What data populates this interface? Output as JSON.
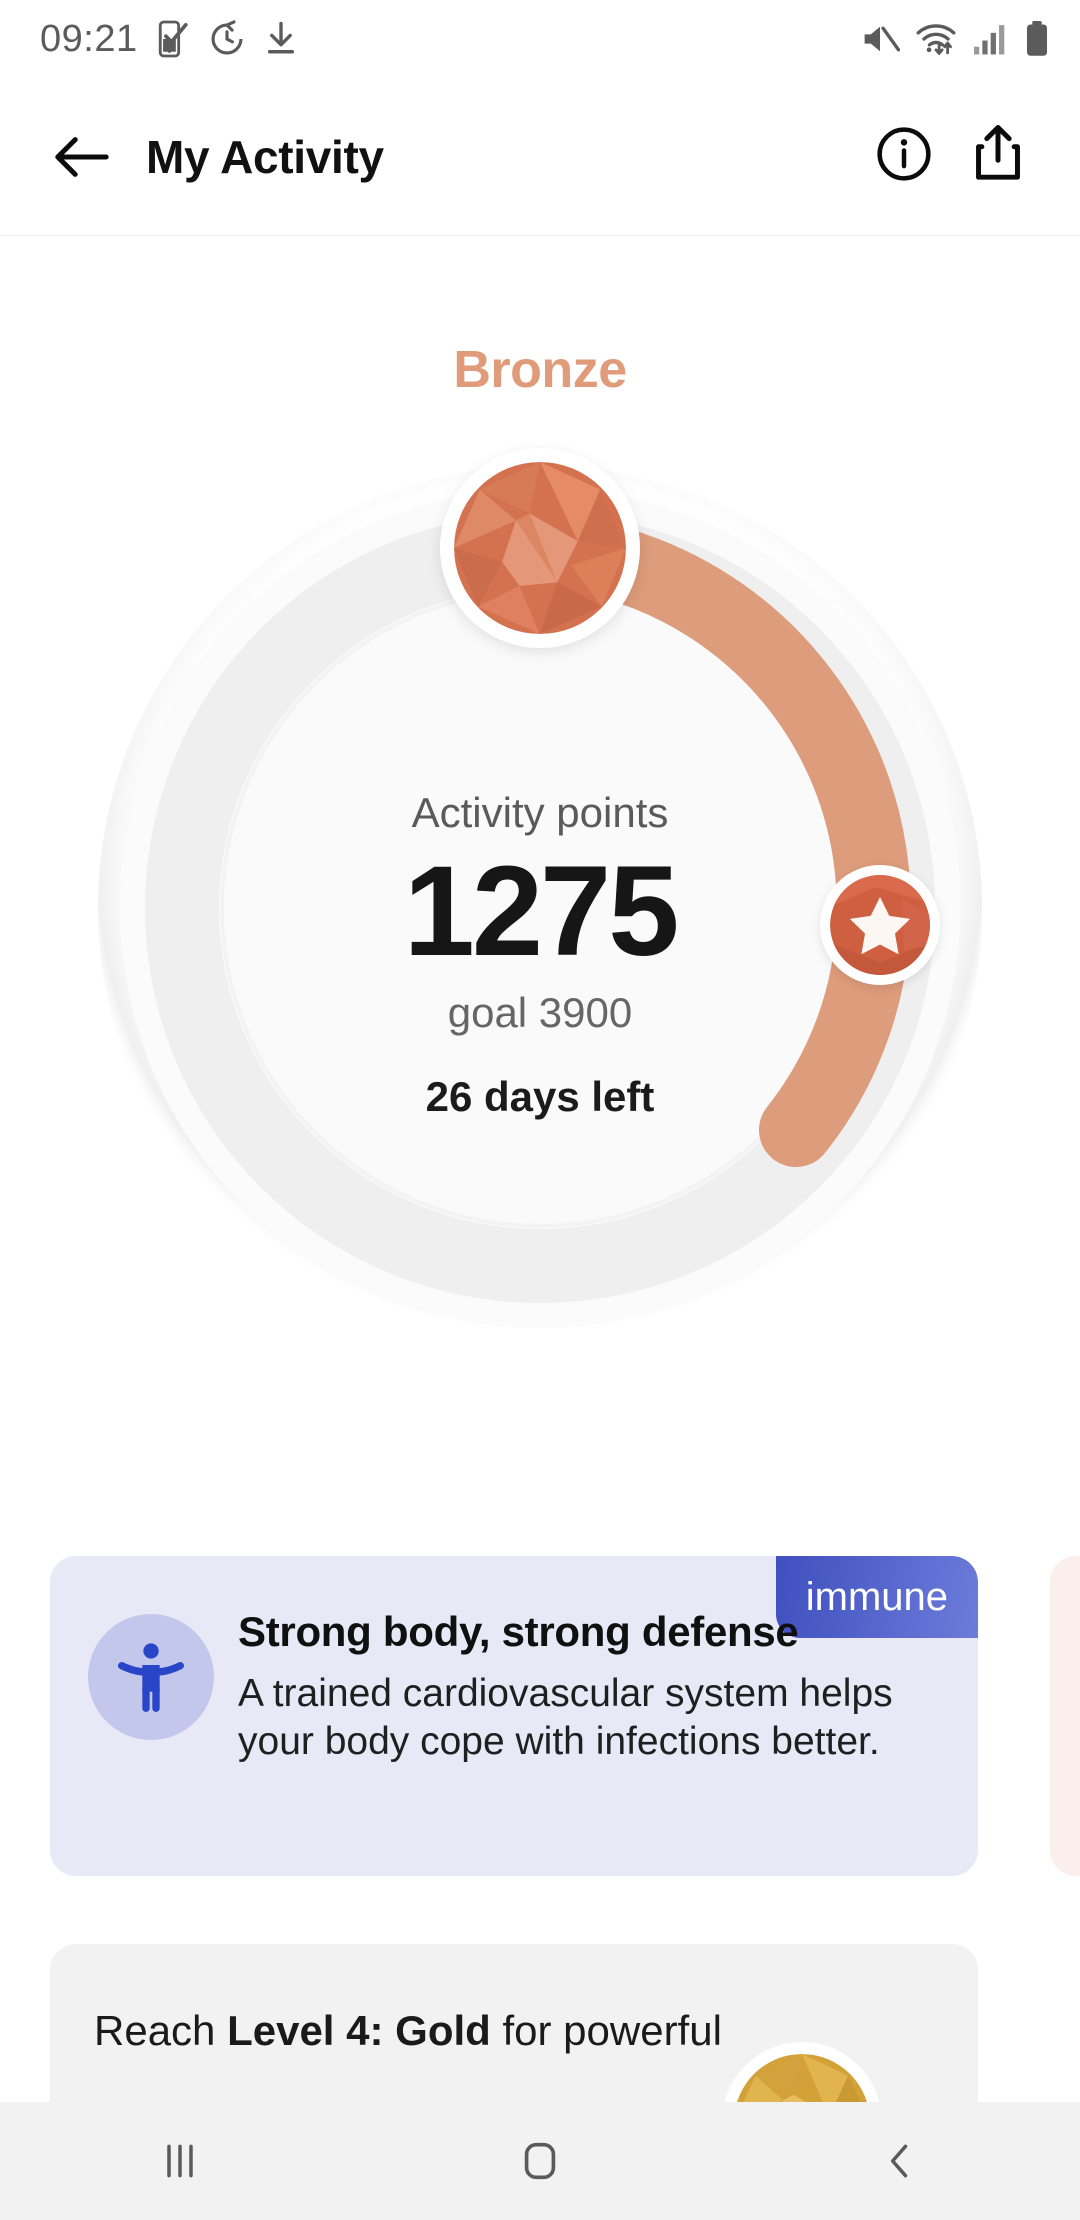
{
  "statusbar": {
    "time": "09:21",
    "left_icons": [
      "phone-check-icon",
      "clock-reset-icon",
      "download-icon"
    ],
    "right_icons": [
      "mute-icon",
      "wifi-icon",
      "signal-icon",
      "battery-icon"
    ]
  },
  "appbar": {
    "back_label": "back-arrow",
    "title": "My Activity",
    "info_label": "info",
    "share_label": "share"
  },
  "activity": {
    "level_name": "Bronze",
    "level_color": "#E09B7A",
    "points_label": "Activity points",
    "points_value": "1275",
    "goal_text": "goal 3900",
    "days_left": "26 days left",
    "points": 1275,
    "goal": 3900,
    "track_color": "#F0F0F0",
    "progress_color": "#DD9C7B"
  },
  "cards": {
    "immune": {
      "badge": "immune",
      "badge_color": "#3F4FBE",
      "background": "#E8E8F7",
      "icon": "accessibility-icon",
      "title": "Strong body, strong defense",
      "description": "A trained cardiovascular system helps your body cope with infections better."
    },
    "peek": {
      "background": "#FAEFEC"
    },
    "gold": {
      "background": "#F2F2F2",
      "text_before": "Reach ",
      "text_bold": "Level 4: Gold",
      "text_after": " for powerful",
      "medal_color": "#D9A938",
      "icon": "gold-medal-icon"
    }
  },
  "navbar": {
    "recents": "recents",
    "home": "home",
    "back": "back"
  }
}
